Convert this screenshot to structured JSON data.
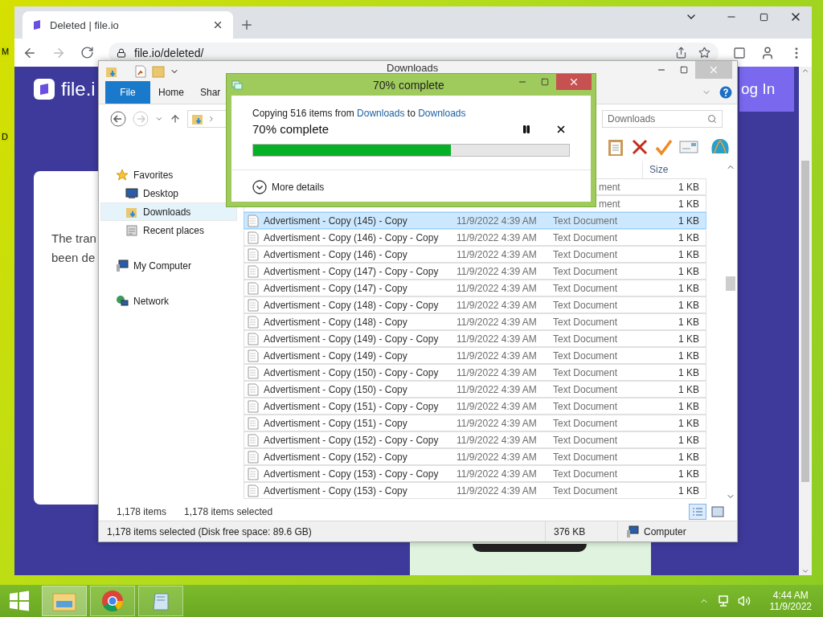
{
  "desktop_icons": [
    {
      "label": "M"
    },
    {
      "label": "D"
    }
  ],
  "browser": {
    "tab": {
      "title": "Deleted | file.io",
      "selected": true
    },
    "url": "file.io/deleted/",
    "page": {
      "logo": "file.i",
      "login": "og In",
      "card_lines": [
        "The tran",
        "been de"
      ]
    }
  },
  "explorer": {
    "title": "Downloads",
    "ribbon_tabs": [
      {
        "label": "File",
        "selected": true
      },
      {
        "label": "Home",
        "selected": false
      },
      {
        "label": "Shar",
        "selected": false
      }
    ],
    "search": {
      "placeholder": "Downloads"
    },
    "columns": [
      {
        "label": "Size"
      }
    ],
    "nav": [
      {
        "label": "Favorites",
        "kind": "favorites",
        "selected": false,
        "children": [
          {
            "label": "Desktop",
            "kind": "desktop",
            "selected": false
          },
          {
            "label": "Downloads",
            "kind": "downloads",
            "selected": true
          },
          {
            "label": "Recent places",
            "kind": "recent",
            "selected": false
          }
        ]
      },
      {
        "label": "My Computer",
        "kind": "computer",
        "selected": false
      },
      {
        "label": "Network",
        "kind": "network",
        "selected": false
      }
    ],
    "rows": [
      {
        "kind": "partial",
        "type": "ment",
        "size": "1 KB",
        "selected": false
      },
      {
        "kind": "partial",
        "type": "ment",
        "size": "1 KB",
        "selected": false
      },
      {
        "kind": "full",
        "name": "Advertisment - Copy (145) - Copy",
        "date": "11/9/2022 4:39 AM",
        "type": "Text Document",
        "size": "1 KB",
        "selected": true
      },
      {
        "kind": "full",
        "name": "Advertisment - Copy (146) - Copy - Copy",
        "date": "11/9/2022 4:39 AM",
        "type": "Text Document",
        "size": "1 KB",
        "selected": false
      },
      {
        "kind": "full",
        "name": "Advertisment - Copy (146) - Copy",
        "date": "11/9/2022 4:39 AM",
        "type": "Text Document",
        "size": "1 KB",
        "selected": false
      },
      {
        "kind": "full",
        "name": "Advertisment - Copy (147) - Copy - Copy",
        "date": "11/9/2022 4:39 AM",
        "type": "Text Document",
        "size": "1 KB",
        "selected": false
      },
      {
        "kind": "full",
        "name": "Advertisment - Copy (147) - Copy",
        "date": "11/9/2022 4:39 AM",
        "type": "Text Document",
        "size": "1 KB",
        "selected": false
      },
      {
        "kind": "full",
        "name": "Advertisment - Copy (148) - Copy - Copy",
        "date": "11/9/2022 4:39 AM",
        "type": "Text Document",
        "size": "1 KB",
        "selected": false
      },
      {
        "kind": "full",
        "name": "Advertisment - Copy (148) - Copy",
        "date": "11/9/2022 4:39 AM",
        "type": "Text Document",
        "size": "1 KB",
        "selected": false
      },
      {
        "kind": "full",
        "name": "Advertisment - Copy (149) - Copy - Copy",
        "date": "11/9/2022 4:39 AM",
        "type": "Text Document",
        "size": "1 KB",
        "selected": false
      },
      {
        "kind": "full",
        "name": "Advertisment - Copy (149) - Copy",
        "date": "11/9/2022 4:39 AM",
        "type": "Text Document",
        "size": "1 KB",
        "selected": false
      },
      {
        "kind": "full",
        "name": "Advertisment - Copy (150) - Copy - Copy",
        "date": "11/9/2022 4:39 AM",
        "type": "Text Document",
        "size": "1 KB",
        "selected": false
      },
      {
        "kind": "full",
        "name": "Advertisment - Copy (150) - Copy",
        "date": "11/9/2022 4:39 AM",
        "type": "Text Document",
        "size": "1 KB",
        "selected": false
      },
      {
        "kind": "full",
        "name": "Advertisment - Copy (151) - Copy - Copy",
        "date": "11/9/2022 4:39 AM",
        "type": "Text Document",
        "size": "1 KB",
        "selected": false
      },
      {
        "kind": "full",
        "name": "Advertisment - Copy (151) - Copy",
        "date": "11/9/2022 4:39 AM",
        "type": "Text Document",
        "size": "1 KB",
        "selected": false
      },
      {
        "kind": "full",
        "name": "Advertisment - Copy (152) - Copy - Copy",
        "date": "11/9/2022 4:39 AM",
        "type": "Text Document",
        "size": "1 KB",
        "selected": false
      },
      {
        "kind": "full",
        "name": "Advertisment - Copy (152) - Copy",
        "date": "11/9/2022 4:39 AM",
        "type": "Text Document",
        "size": "1 KB",
        "selected": false
      },
      {
        "kind": "full",
        "name": "Advertisment - Copy (153) - Copy - Copy",
        "date": "11/9/2022 4:39 AM",
        "type": "Text Document",
        "size": "1 KB",
        "selected": false
      },
      {
        "kind": "full",
        "name": "Advertisment - Copy (153) - Copy",
        "date": "11/9/2022 4:39 AM",
        "type": "Text Document",
        "size": "1 KB",
        "selected": false
      }
    ],
    "item_count": "1,178 items",
    "selected_count": "1,178 items selected",
    "status": "1,178 items selected (Disk free space: 89.6 GB)",
    "status_size": "376 KB",
    "status_location": "Computer"
  },
  "copy_dialog": {
    "title": "70% complete",
    "prefix": "Copying 516 items from",
    "source": "Downloads",
    "middle": "to",
    "destination": "Downloads",
    "progress_text": "70% complete",
    "level": 0.625,
    "details": "More details"
  },
  "taskbar": {
    "apps": [
      {
        "kind": "explorer",
        "selected": true
      },
      {
        "kind": "chrome",
        "selected": false
      },
      {
        "kind": "notepad",
        "selected": false
      }
    ],
    "time": "4:44 AM",
    "date": "11/9/2022"
  }
}
